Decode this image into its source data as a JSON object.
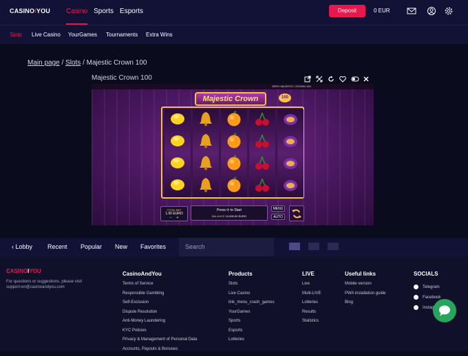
{
  "header": {
    "logo_left": "CASINO",
    "logo_mid": "I",
    "logo_right": "YOU",
    "nav": [
      "Casino",
      "Sports",
      "Esports"
    ],
    "deposit_label": "Deposit",
    "balance": "0  EUR",
    "icons": [
      "mail-icon",
      "user-icon",
      "settings-icon"
    ]
  },
  "subnav": [
    "Slots",
    "Live Casino",
    "YourGames",
    "Tournaments",
    "Extra Wins"
  ],
  "breadcrumb": {
    "home": "Main page",
    "sep1": "/",
    "section": "Slots",
    "sep2": "/",
    "current": "Majestic Crown 100"
  },
  "game": {
    "title": "Majestic Crown 100",
    "banner": "Majestic Crown",
    "badge": "100",
    "toolbar_icons": [
      "external-link-icon",
      "fullscreen-icon",
      "reload-icon",
      "favorite-icon",
      "toggle-icon",
      "close-icon"
    ],
    "top_text": "SERO  MAJESTIC CROWN 100",
    "total_bet_label": "TOTAL BET",
    "total_bet_value": "1.00 EURO",
    "press_text": "Press",
    "to_start": "to Start",
    "balance_label": "BALANCE",
    "balance_value": "10,000.00 EURO",
    "menu_label": "MENU",
    "auto_label": "AUTO",
    "minus": "−",
    "plus": "+",
    "reels": [
      [
        "lemon",
        "lemon",
        "lemon",
        "lemon"
      ],
      [
        "bell",
        "bell",
        "bell",
        "bell"
      ],
      [
        "orange",
        "orange",
        "orange",
        "orange"
      ],
      [
        "cherry",
        "cherry",
        "cherry",
        "cherry"
      ],
      [
        "plum",
        "plum",
        "plum",
        "plum"
      ]
    ]
  },
  "lobbybar": {
    "items": [
      "Lobby",
      "Recent",
      "Popular",
      "New",
      "Favorites"
    ],
    "search_placeholder": "Search"
  },
  "footer": {
    "logo_left": "CASINO",
    "logo_mid": "I",
    "logo_right": "YOU",
    "note_line1": "For questions or suggestions, please visit",
    "note_line2": "support-en@casinoandyou.com",
    "columns": [
      {
        "title": "CasinoAndYou",
        "links": [
          "Terms of Service",
          "Responsible Gambling",
          "Self-Exclusion",
          "Dispute Resolution",
          "Anti-Money Laundering",
          "KYC Policies",
          "Privacy & Management of Personal Data",
          "Accounts, Payouts & Bonuses"
        ]
      },
      {
        "title": "Products",
        "links": [
          "Slots",
          "Live Casino",
          "link_menu_crash_games",
          "YourGames",
          "Sports",
          "Esports",
          "Lotteries"
        ]
      },
      {
        "title": "LIVE",
        "links": [
          "Live",
          "Multi-LIVE",
          "Lotteries",
          "Results",
          "Statistics"
        ]
      },
      {
        "title": "Useful links",
        "links": [
          "Mobile version",
          "PWA installation guide",
          "Blog"
        ]
      },
      {
        "title": "SOCIALS",
        "links": [
          "Telegram",
          "Facebook",
          "Instagram"
        ]
      }
    ]
  },
  "colors": {
    "accent": "#e8174d",
    "chat": "#26a65b",
    "header_bg": "#121236"
  }
}
